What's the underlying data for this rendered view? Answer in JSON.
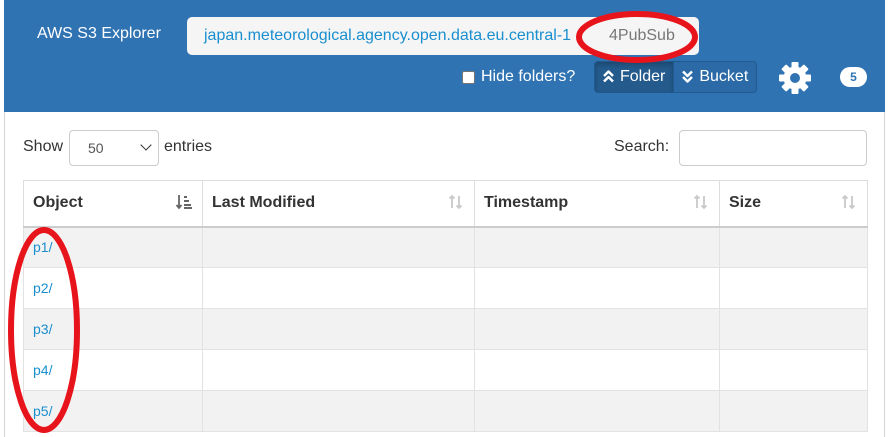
{
  "navbar": {
    "brand": "AWS S3 Explorer",
    "breadcrumb": {
      "bucket": "japan.meteorological.agency.open.data.eu.central-1",
      "separator": "/",
      "current": "4PubSub"
    },
    "hide_folders_label": "Hide folders?",
    "hide_folders_checked": false,
    "folder_button": "Folder",
    "bucket_button": "Bucket",
    "object_count": "5"
  },
  "table_controls": {
    "show_label": "Show",
    "page_length": "50",
    "entries_label": "entries",
    "search_label": "Search:",
    "search_value": ""
  },
  "table": {
    "columns": [
      "Object",
      "Last Modified",
      "Timestamp",
      "Size"
    ],
    "rows": [
      {
        "object": "p1/",
        "last_modified": "",
        "timestamp": "",
        "size": ""
      },
      {
        "object": "p2/",
        "last_modified": "",
        "timestamp": "",
        "size": ""
      },
      {
        "object": "p3/",
        "last_modified": "",
        "timestamp": "",
        "size": ""
      },
      {
        "object": "p4/",
        "last_modified": "",
        "timestamp": "",
        "size": ""
      },
      {
        "object": "p5/",
        "last_modified": "",
        "timestamp": "",
        "size": ""
      }
    ]
  },
  "colors": {
    "navbar": "#2f73b3",
    "link": "#1a8fcf",
    "annotation": "#e8141c"
  }
}
